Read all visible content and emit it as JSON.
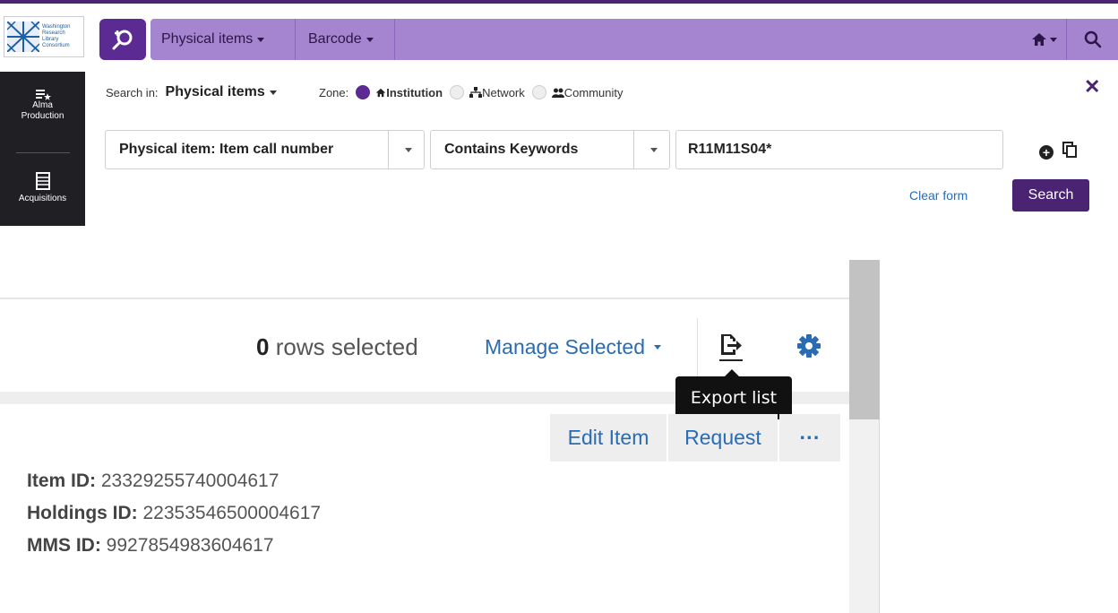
{
  "header": {
    "logo": {
      "lines": [
        "Washington",
        "Research",
        "Library",
        "Consortium"
      ]
    },
    "nav_items": [
      {
        "label": "Physical items"
      },
      {
        "label": "Barcode"
      }
    ]
  },
  "leftnav": {
    "items": [
      {
        "label_line1": "Alma",
        "label_line2": "Production"
      },
      {
        "label_line1": "Acquisitions"
      }
    ]
  },
  "search": {
    "search_in_label": "Search in:",
    "search_in_value": "Physical items",
    "zone_label": "Zone:",
    "zones": [
      {
        "label": "Institution",
        "selected": true
      },
      {
        "label": "Network",
        "selected": false
      },
      {
        "label": "Community",
        "selected": false
      }
    ],
    "field": "Physical item: Item call number",
    "operator": "Contains Keywords",
    "value": "R11M11S04*",
    "clear_label": "Clear form",
    "search_label": "Search"
  },
  "results": {
    "rows_selected_count": "0",
    "rows_selected_text": "rows selected",
    "manage_selected_label": "Manage Selected",
    "tooltip": "Export list",
    "actions": {
      "edit": "Edit Item",
      "request": "Request",
      "more": "···"
    },
    "item": {
      "item_id_label": "Item ID:",
      "item_id": "23329255740004617",
      "holdings_id_label": "Holdings ID:",
      "holdings_id": "22353546500004617",
      "mms_id_label": "MMS ID:",
      "mms_id": "9927854983604617"
    }
  },
  "colors": {
    "accent": "#4a2473",
    "bar": "#a585cf",
    "link": "#2a6cb3",
    "nav_bg": "#1f1f24"
  }
}
